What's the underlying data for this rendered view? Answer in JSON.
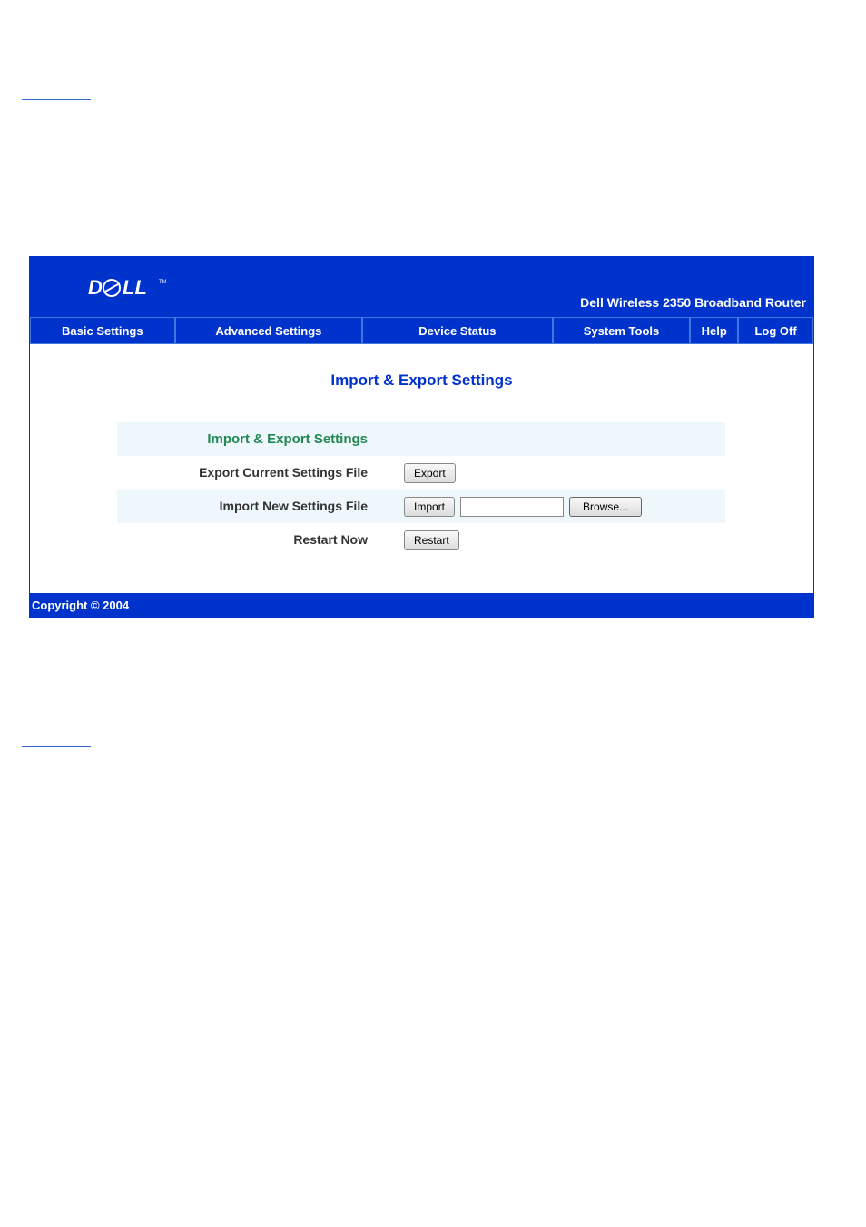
{
  "header": {
    "product_name": "Dell Wireless 2350 Broadband Router"
  },
  "nav": {
    "basic_settings": "Basic Settings",
    "advanced_settings": "Advanced Settings",
    "device_status": "Device Status",
    "system_tools": "System Tools",
    "help": "Help",
    "log_off": "Log Off"
  },
  "content": {
    "page_title": "Import & Export Settings",
    "section_header": "Import & Export Settings",
    "rows": {
      "export": {
        "label": "Export Current Settings File",
        "button": "Export"
      },
      "import": {
        "label": "Import New Settings File",
        "button": "Import",
        "browse_button": "Browse..."
      },
      "restart": {
        "label": "Restart Now",
        "button": "Restart"
      }
    }
  },
  "footer": {
    "copyright": "Copyright © 2004"
  }
}
